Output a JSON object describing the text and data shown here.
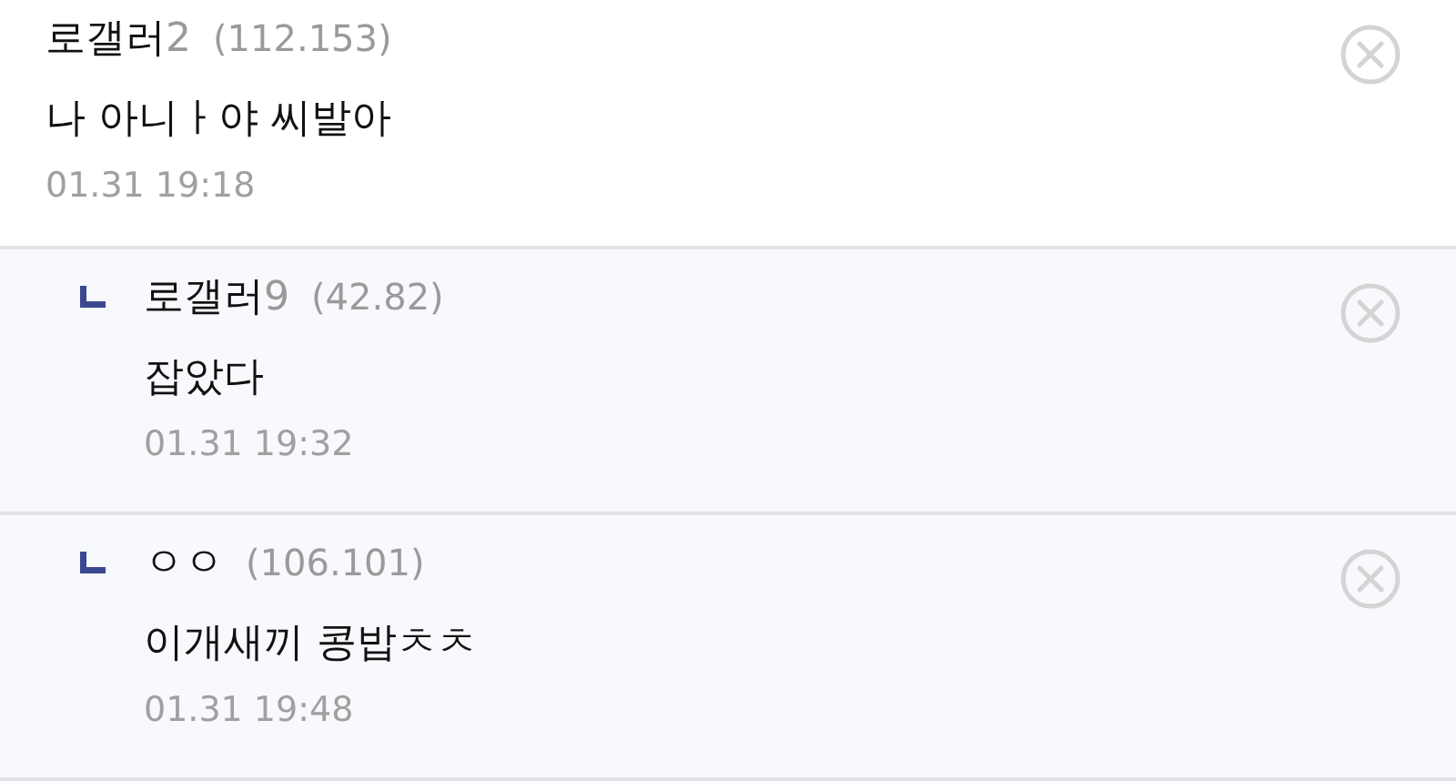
{
  "comments": [
    {
      "kind": "comment",
      "nickname": "로갤러",
      "nickname_suffix": "2",
      "ip": "(112.153)",
      "body": "나 아니ㅏ야 씨발아",
      "time": "01.31 19:18"
    },
    {
      "kind": "reply",
      "nickname": "로갤러",
      "nickname_suffix": "9",
      "ip": "(42.82)",
      "body": "잡았다",
      "time": "01.31 19:32"
    },
    {
      "kind": "reply",
      "nickname": "ㅇㅇ",
      "ip": "(106.101)",
      "body": "이개새끼 콩밥ㅊㅊ",
      "time": "01.31 19:48"
    }
  ]
}
